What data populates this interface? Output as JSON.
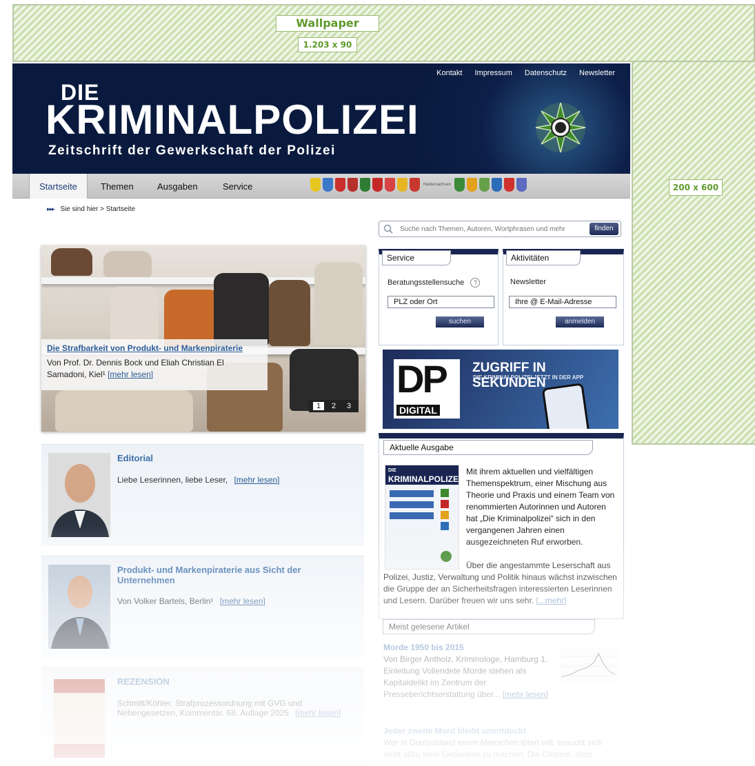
{
  "wallpaper": {
    "label": "Wallpaper",
    "size": "1.203 x 90",
    "side_size": "200 x 600"
  },
  "header": {
    "top_links": [
      "Kontakt",
      "Impressum",
      "Datenschutz",
      "Newsletter"
    ],
    "logo_die": "DIE",
    "logo_main": "KRIMINALPOLIZEI",
    "logo_sub": "Zeitschrift der Gewerkschaft der Polizei"
  },
  "nav": {
    "items": [
      "Startseite",
      "Themen",
      "Ausgaben",
      "Service"
    ],
    "crest_label": "Niedersachsen"
  },
  "breadcrumb": {
    "arrows": "▸▸▸",
    "text": "Sie sind hier > Startseite"
  },
  "slider": {
    "title": "Die Strafbarkeit von Produkt- und Markenpiraterie",
    "text": "Von Prof. Dr. Dennis Bock und Eliah Christian El Samadoni, Kiel¹",
    "more": "[mehr lesen]",
    "pages": [
      "1",
      "2",
      "3"
    ]
  },
  "articles": [
    {
      "heading": "Editorial",
      "body": "Liebe Leserinnen, liebe Leser,",
      "more": "[mehr lesen]"
    },
    {
      "heading": "Produkt- und Markenpiraterie aus Sicht der Unternehmen",
      "body": "Von Volker Bartels, Berlin¹",
      "more": "[mehr lesen]"
    },
    {
      "heading": "REZENSION",
      "body": "Schmitt/Köhler, Strafprozessordnung mit GVG und Nebengesetzen, Kommentar. 68. Auflage 2025",
      "more": "[mehr lesen]"
    }
  ],
  "search": {
    "placeholder": "Suche nach Themen, Autoren, Wortphrasen und mehr",
    "button": "finden"
  },
  "service_widget": {
    "tab": "Service",
    "label": "Beratungsstellensuche",
    "help": "?",
    "input": "PLZ oder Ort",
    "button": "suchen"
  },
  "activities_widget": {
    "tab": "Aktivitäten",
    "label": "Newsletter",
    "input": "Ihre @ E-Mail-Adresse",
    "button": "anmelden"
  },
  "dp_ad": {
    "letters": "DP",
    "digital": "DIGITAL",
    "headline": "ZUGRIFF IN SEKUNDEN",
    "sub": "DIE KRIMINALPOLIZEI JETZT IN DER APP"
  },
  "issue": {
    "tab": "Aktuelle Ausgabe",
    "cover_die": "DIE",
    "cover_title": "KRIMINALPOLIZEI",
    "text_indented": "Mit ihrem aktuellen und vielfältigen Themenspektrum, einer Mischung aus Theorie und Praxis und einem Team von renommierten Autorinnen und Autoren hat „Die Kriminalpolizei“ sich in den vergangenen Jahren einen ausgezeichneten Ruf erworben.",
    "text_indented_2": "Über die angestammte Leserschaft aus",
    "text_full": "Polizei, Justiz, Verwaltung und Politik hinaus wächst inzwischen die Gruppe der an Sicherheitsfragen interessierten Leserinnen und Lesern. Darüber freuen wir uns sehr.",
    "more": "[...mehr]"
  },
  "popular": {
    "tab": "Meist gelesene Artikel",
    "items": [
      {
        "title": "Morde 1950 bis 2015",
        "text": "Von Birger Antholz, Kriminologe, Hamburg 1. Einleitung Vollendete Morde stehen als Kapitaldelikt im Zentrum der Presseberichtserstattung über...",
        "more": "[mehr lesen]"
      },
      {
        "title": "Jeder zweite Mord bleibt unentdeckt",
        "text": "Wer in Deutschland einen Menschen töten will, braucht sich nicht allzu viele Gedanken zu machen. Die Chance, dass"
      }
    ]
  },
  "colors": {
    "header_bg": "#0d1f48",
    "link_blue": "#2b5c96",
    "wallpaper_green": "#9cbc74"
  }
}
